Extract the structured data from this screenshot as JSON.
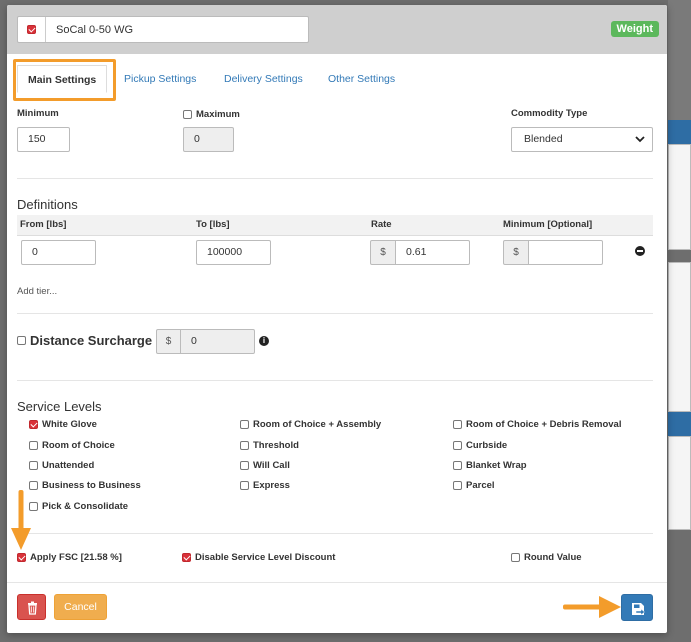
{
  "header": {
    "title_value": "SoCal 0-50 WG",
    "title_checked": true,
    "badge": "Weight"
  },
  "tabs": [
    {
      "label": "Main Settings",
      "active": true
    },
    {
      "label": "Pickup Settings",
      "active": false
    },
    {
      "label": "Delivery Settings",
      "active": false
    },
    {
      "label": "Other Settings",
      "active": false
    }
  ],
  "main": {
    "minimum_label": "Minimum",
    "minimum_value": "150",
    "maximum_label": "Maximum",
    "maximum_checked": false,
    "maximum_value": "0",
    "commodity_label": "Commodity Type",
    "commodity_value": "Blended"
  },
  "definitions": {
    "title": "Definitions",
    "columns": [
      "From [lbs]",
      "To [lbs]",
      "Rate",
      "Minimum [Optional]"
    ],
    "rows": [
      {
        "from": "0",
        "to": "100000",
        "rate_prefix": "$",
        "rate": "0.61",
        "min_prefix": "$",
        "min": ""
      }
    ],
    "add_tier": "Add tier..."
  },
  "distance": {
    "label": "Distance Surcharge",
    "checked": false,
    "prefix": "$",
    "value": "0"
  },
  "service_levels": {
    "title": "Service Levels",
    "items": [
      {
        "label": "White Glove",
        "checked": true
      },
      {
        "label": "Room of Choice + Assembly",
        "checked": false
      },
      {
        "label": "Room of Choice + Debris Removal",
        "checked": false
      },
      {
        "label": "Room of Choice",
        "checked": false
      },
      {
        "label": "Threshold",
        "checked": false
      },
      {
        "label": "Curbside",
        "checked": false
      },
      {
        "label": "Unattended",
        "checked": false
      },
      {
        "label": "Will Call",
        "checked": false
      },
      {
        "label": "Blanket Wrap",
        "checked": false
      },
      {
        "label": "Business to Business",
        "checked": false
      },
      {
        "label": "Express",
        "checked": false
      },
      {
        "label": "Parcel",
        "checked": false
      },
      {
        "label": "Pick & Consolidate",
        "checked": false
      }
    ]
  },
  "options": {
    "apply_fsc": "Apply FSC [21.58 %]",
    "apply_fsc_checked": true,
    "disable_discount": "Disable Service Level Discount",
    "disable_discount_checked": true,
    "round_value": "Round Value",
    "round_value_checked": false
  },
  "footer": {
    "cancel_label": "Cancel"
  },
  "colors": {
    "accent": "#337ab7",
    "danger": "#d9534f",
    "warning": "#f0ad4e",
    "success": "#5cb85c",
    "highlight": "#f39c2b"
  }
}
